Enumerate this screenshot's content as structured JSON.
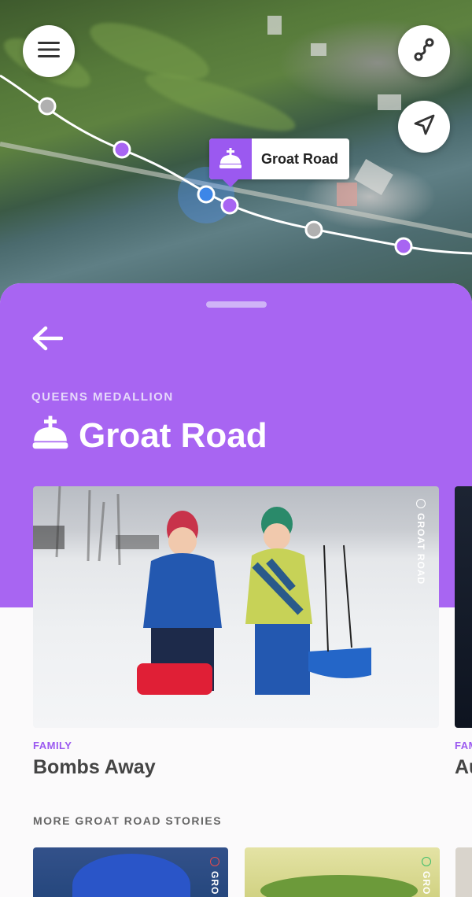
{
  "map": {
    "menu_icon": "hamburger-icon",
    "route_icon": "route-icon",
    "locate_icon": "navigation-arrow-icon",
    "marker_label": "Groat Road",
    "marker_icon": "medallion-crown-icon",
    "colors": {
      "route": "#ffffff",
      "stop_visited": "#b0b0b0",
      "stop_purple": "#a865f2",
      "current": "#3d86e8"
    }
  },
  "sheet": {
    "back_icon": "arrow-left-icon",
    "eyebrow": "QUEENS MEDALLION",
    "title": "Groat Road",
    "title_icon": "medallion-crown-icon",
    "accent": "#a865f2",
    "featured": [
      {
        "tag": "GROAT ROAD",
        "category": "FAMILY",
        "title": "Bombs Away"
      },
      {
        "tag": "",
        "category": "FAM",
        "title": "Au"
      }
    ],
    "more_heading": "MORE GROAT ROAD STORIES",
    "more_stories": [
      {
        "tag": "GRO",
        "dot_color": "#e84b4b"
      },
      {
        "tag": "GRO",
        "dot_color": "#3bbd6a"
      },
      {
        "tag": "",
        "dot_color": ""
      }
    ]
  }
}
